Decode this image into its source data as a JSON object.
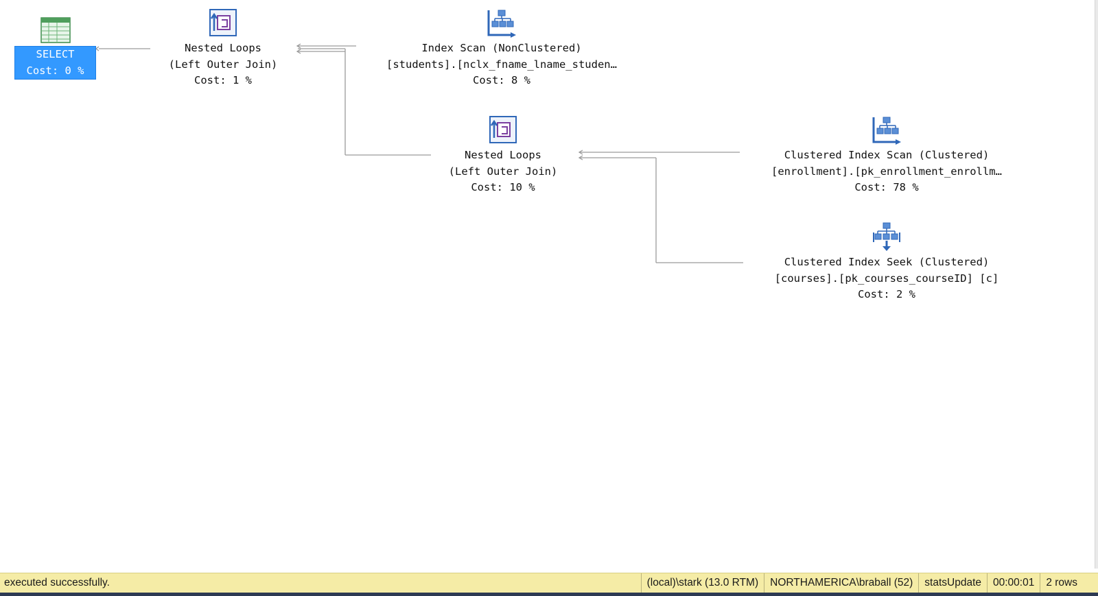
{
  "plan": {
    "nodes": {
      "select": {
        "line1": "SELECT",
        "cost": "Cost: 0 %",
        "icon": "result-grid-icon"
      },
      "nested_loops_1": {
        "line1": "Nested Loops",
        "line2": "(Left Outer Join)",
        "cost": "Cost: 1 %",
        "icon": "nested-loops-icon"
      },
      "index_scan": {
        "line1": "Index Scan (NonClustered)",
        "line2": "[students].[nclx_fname_lname_studen…",
        "cost": "Cost: 8 %",
        "icon": "index-scan-icon"
      },
      "nested_loops_2": {
        "line1": "Nested Loops",
        "line2": "(Left Outer Join)",
        "cost": "Cost: 10 %",
        "icon": "nested-loops-icon"
      },
      "clustered_scan": {
        "line1": "Clustered Index Scan (Clustered)",
        "line2": "[enrollment].[pk_enrollment_enrollm…",
        "cost": "Cost: 78 %",
        "icon": "clustered-index-scan-icon"
      },
      "clustered_seek": {
        "line1": "Clustered Index Seek (Clustered)",
        "line2": "[courses].[pk_courses_courseID] [c]",
        "cost": "Cost: 2 %",
        "icon": "clustered-index-seek-icon"
      }
    }
  },
  "status": {
    "message": "executed successfully.",
    "server": "(local)\\stark (13.0 RTM)",
    "user": "NORTHAMERICA\\braball (52)",
    "database": "statsUpdate",
    "elapsed": "00:00:01",
    "rows": "2 rows"
  },
  "colors": {
    "selection": "#3399ff",
    "status_bar": "#f5eca6",
    "connector": "#9a9a9a"
  }
}
